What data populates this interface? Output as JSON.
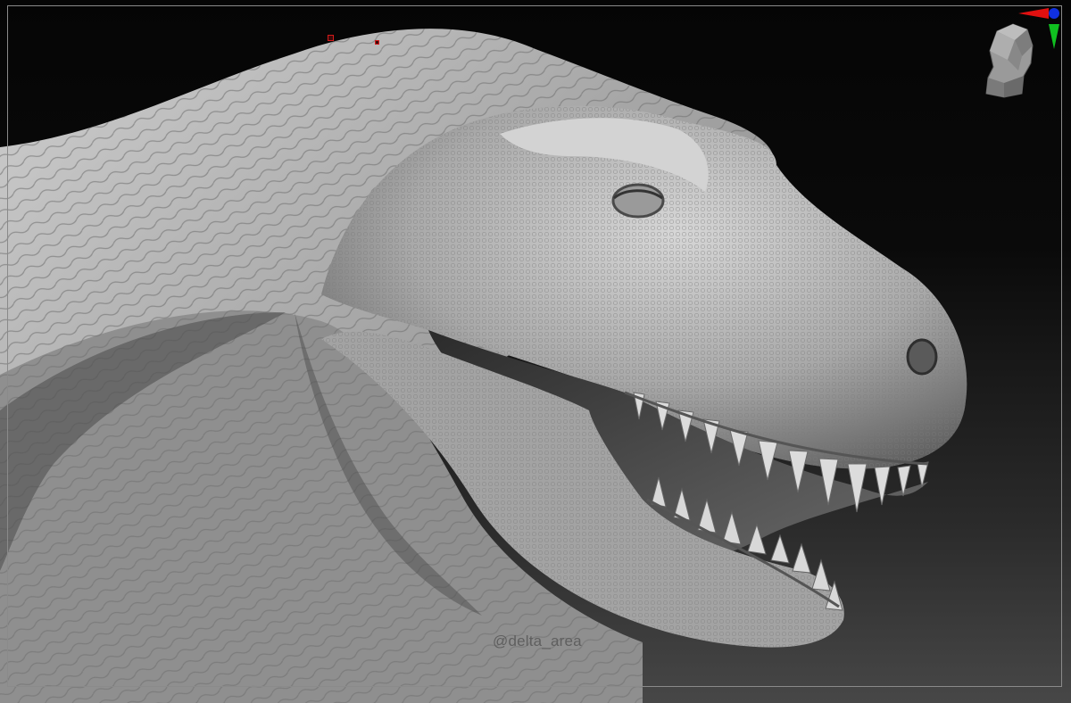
{
  "viewport": {
    "watermark": "@delta_area"
  },
  "navigation_gizmo": {
    "icon": "head-orientation-icon",
    "axis_colors": {
      "x": "#e01010",
      "y": "#10c020",
      "z": "#1030e0"
    }
  },
  "colors": {
    "background_top": "#050505",
    "background_bottom": "#474747",
    "clay": "#bdbdbd",
    "border": "#8a8a8a"
  }
}
